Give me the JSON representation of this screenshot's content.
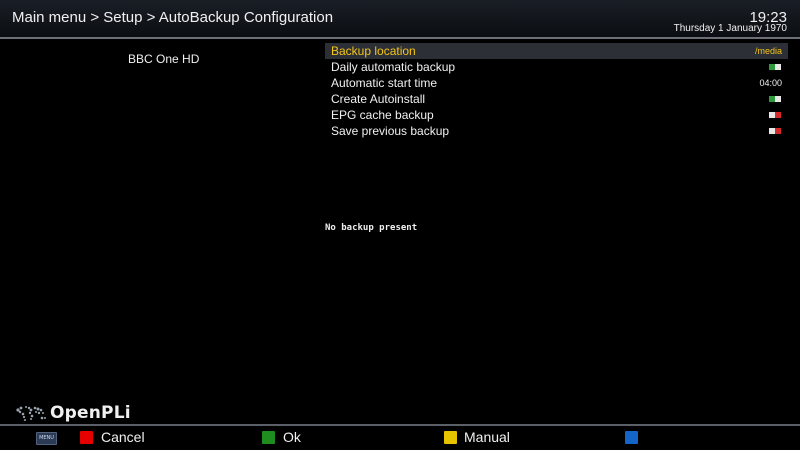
{
  "header": {
    "breadcrumb": "Main menu > Setup > AutoBackup Configuration",
    "time": "19:23",
    "date": "Thursday  1 January 1970"
  },
  "service": {
    "name": "BBC One HD"
  },
  "config": {
    "items": [
      {
        "label": "Backup location",
        "value": "/media",
        "kind": "text",
        "selected": true
      },
      {
        "label": "Daily automatic backup",
        "value": "on",
        "kind": "toggle"
      },
      {
        "label": "Automatic start time",
        "value": "04:00",
        "kind": "text"
      },
      {
        "label": "Create Autoinstall",
        "value": "on",
        "kind": "toggle"
      },
      {
        "label": "EPG cache backup",
        "value": "off",
        "kind": "toggle"
      },
      {
        "label": "Save previous backup",
        "value": "off",
        "kind": "toggle"
      }
    ]
  },
  "status": {
    "text": "No backup present"
  },
  "logo": {
    "text": "OpenPLi"
  },
  "footer": {
    "menu_label": "MENU",
    "red_label": "Cancel",
    "green_label": "Ok",
    "yellow_label": "Manual",
    "blue_label": ""
  },
  "colors": {
    "accent": "#f5c518",
    "red_key": "#e60000",
    "green_key": "#1e8c1e",
    "yellow_key": "#e6c200",
    "blue_key": "#1565c8"
  }
}
